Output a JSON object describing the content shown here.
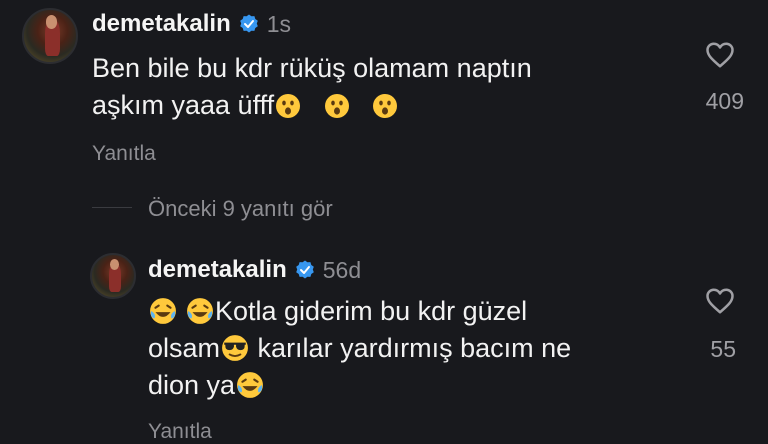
{
  "comment1": {
    "username": "demetakalin",
    "time": "1s",
    "text_line1": "Ben bile bu kdr rüküş olamam naptın",
    "text_line2": "aşkım yaaa üfff",
    "reply_label": "Yanıtla",
    "likes": "409",
    "emoji": "astonished-face"
  },
  "view_previous": "Önceki 9 yanıtı gör",
  "comment2": {
    "username": "demetakalin",
    "time": "56d",
    "text_line1": "Kotla giderim bu kdr güzel",
    "text_line2_a": "olsam",
    "text_line2_b": "karılar yardırmış bacım ne",
    "text_line3": "dion ya",
    "reply_label": "Yanıtla",
    "likes": "55"
  },
  "colors": {
    "background": "#18191d",
    "verified": "#3797f0",
    "secondary_text": "#8e8e93"
  }
}
